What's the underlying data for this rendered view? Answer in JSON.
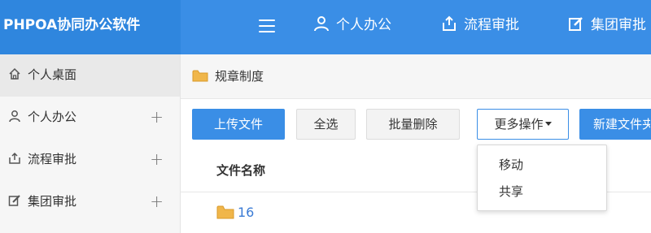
{
  "header": {
    "brand": "PHPOA协同办公软件",
    "nav": [
      {
        "label": "个人办公",
        "icon": "user-icon"
      },
      {
        "label": "流程审批",
        "icon": "flow-icon"
      },
      {
        "label": "集团审批",
        "icon": "edit-icon"
      }
    ]
  },
  "sidebar": {
    "items": [
      {
        "label": "个人桌面",
        "icon": "home-icon",
        "expandable": false
      },
      {
        "label": "个人办公",
        "icon": "user-icon",
        "expand": "+"
      },
      {
        "label": "流程审批",
        "icon": "flow-icon",
        "expand": "+"
      },
      {
        "label": "集团审批",
        "icon": "edit-icon",
        "expand": "+"
      }
    ]
  },
  "breadcrumb": {
    "label": "规章制度",
    "icon": "folder-icon"
  },
  "toolbar": {
    "upload": "上传文件",
    "select_all": "全选",
    "batch_delete": "批量删除",
    "more_actions": "更多操作",
    "new_folder": "新建文件夹"
  },
  "dropdown": {
    "items": [
      "移动",
      "共享"
    ]
  },
  "table": {
    "columns": [
      "文件名称"
    ],
    "rows": [
      {
        "name": "16",
        "icon": "folder-icon"
      }
    ]
  },
  "colors": {
    "primary": "#3a8ee6",
    "brand_bg": "#2f86de",
    "sidebar_bg": "#f6f6f6",
    "folder": "#f0b64a",
    "link": "#3a7bd5"
  }
}
